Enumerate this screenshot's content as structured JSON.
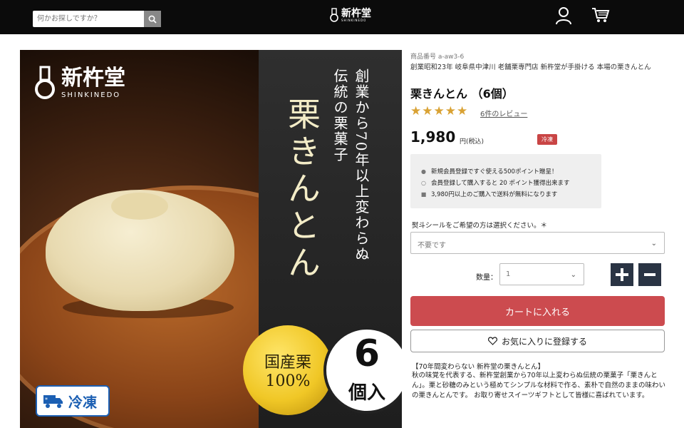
{
  "header": {
    "search_placeholder": "何かお探しですか？",
    "logo_text": "新杵堂",
    "logo_sub": "SHINKINEDO"
  },
  "hero": {
    "brand": "新杵堂",
    "brand_sub": "SHINKINEDO",
    "tagline_line1": "創業から70年以上変わらぬ",
    "tagline_line2": "伝統の栗菓子",
    "product_vertical": "栗きんとん",
    "domestic_line1": "国産栗",
    "domestic_line2": "100%",
    "count_number": "6",
    "count_unit": "個入",
    "frozen_label": "冷凍"
  },
  "product": {
    "sku": "商品番号 a-aw3-6",
    "catch_copy": "創業昭和23年 岐阜県中津川 老舗栗専門店 新杵堂が手掛ける 本場の栗きんとん",
    "title": "栗きんとん （6個）",
    "rating_stars": 5,
    "review_link": "6件のレビュー",
    "price": "1,980",
    "price_suffix": "円(税込)",
    "badge": "冷凍",
    "promo": [
      {
        "icon": "person-icon",
        "text": "新規会員登録ですぐ使える500ポイント贈呈！"
      },
      {
        "icon": "points-icon",
        "text": "会員登録して購入すると 20 ポイント獲得出来ます"
      },
      {
        "icon": "truck-icon",
        "text": "3,980円以上のご購入で送料が無料になります"
      }
    ],
    "noshi_label": "熨斗シールをご希望の方は選択ください。＊",
    "noshi_selected": "不要です",
    "qty_label": "数量：",
    "qty_value": "1",
    "cart_button": "カートに入れる",
    "fav_button": "お気に入りに登録する",
    "desc_heading": "【70年間変わらない 新杵堂の栗きんとん】",
    "description": "秋の味覚を代表する、新杵堂創業から70年以上変わらぬ伝統の栗菓子「栗きんとん」。栗と砂糖のみという極めてシンプルな材料で作る、素朴で自然のままの味わいの栗きんとんです。 お取り寄せスイーツギフトとして皆様に喜ばれています。"
  },
  "colors": {
    "header_bg": "#0b0b0b",
    "cart_button": "#cc4b4f",
    "star": "#d9a234",
    "qty_button": "#2a3444",
    "badge": "#c94545"
  }
}
